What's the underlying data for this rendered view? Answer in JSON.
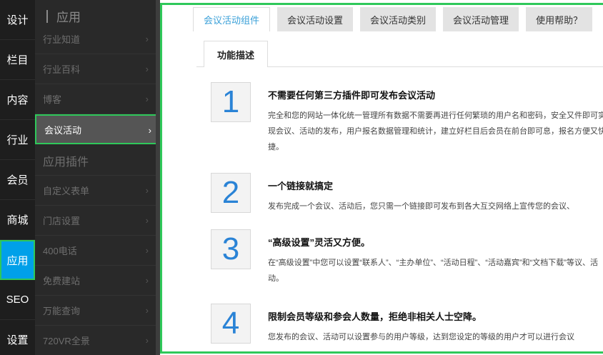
{
  "main_nav": [
    {
      "label": "设计"
    },
    {
      "label": "栏目"
    },
    {
      "label": "内容"
    },
    {
      "label": "行业"
    },
    {
      "label": "会员"
    },
    {
      "label": "商城"
    },
    {
      "label": "应用",
      "active": true
    },
    {
      "label": "SEO"
    },
    {
      "label": "设置"
    }
  ],
  "sub_nav": {
    "title": "应用",
    "items": [
      {
        "label": "行业知道"
      },
      {
        "label": "行业百科"
      },
      {
        "label": "博客"
      },
      {
        "label": "会议活动",
        "active": true
      }
    ],
    "group_title": "应用插件",
    "plugin_items": [
      {
        "label": "自定义表单"
      },
      {
        "label": "门店设置"
      },
      {
        "label": "400电话"
      },
      {
        "label": "免费建站"
      },
      {
        "label": "万能查询"
      },
      {
        "label": "720VR全景"
      }
    ],
    "chevron": "›"
  },
  "tabs": [
    {
      "label": "会议活动组件",
      "active": true
    },
    {
      "label": "会议活动设置"
    },
    {
      "label": "会议活动类别"
    },
    {
      "label": "会议活动管理"
    },
    {
      "label": "使用帮助？"
    }
  ],
  "subtab": {
    "label": "功能描述"
  },
  "features": [
    {
      "number": "1",
      "title": "不需要任何第三方插件即可发布会议活动",
      "desc": "完全和您的网站一体化统一管理所有数据不需要再进行任何繁琐的用户名和密码，安全又件即可实现会议、活动的发布，用户报名数据管理和统计，建立好栏目后会员在前台即可息，报名方便又快捷。"
    },
    {
      "number": "2",
      "title": "一个链接就搞定",
      "desc": "发布完成一个会议、活动后，您只需一个链接即可发布到各大互交网络上宣传您的会议、"
    },
    {
      "number": "3",
      "title": "“高级设置”灵活又方便。",
      "desc": "在“高级设置”中您可以设置“联系人”、“主办单位”、“活动日程”、“活动嘉宾”和“文档下载”等议、活动。"
    },
    {
      "number": "4",
      "title": "限制会员等级和参会人数量，拒绝非相关人士空降。",
      "desc": "您发布的会议、活动可以设置参与的用户等级，达到您设定的等级的用户才可以进行会议"
    }
  ],
  "colors": {
    "accent": "#00a0e9",
    "highlight_border": "#2fc85a",
    "number": "#2a83d6",
    "active_tab_text": "#3aa0d8"
  }
}
